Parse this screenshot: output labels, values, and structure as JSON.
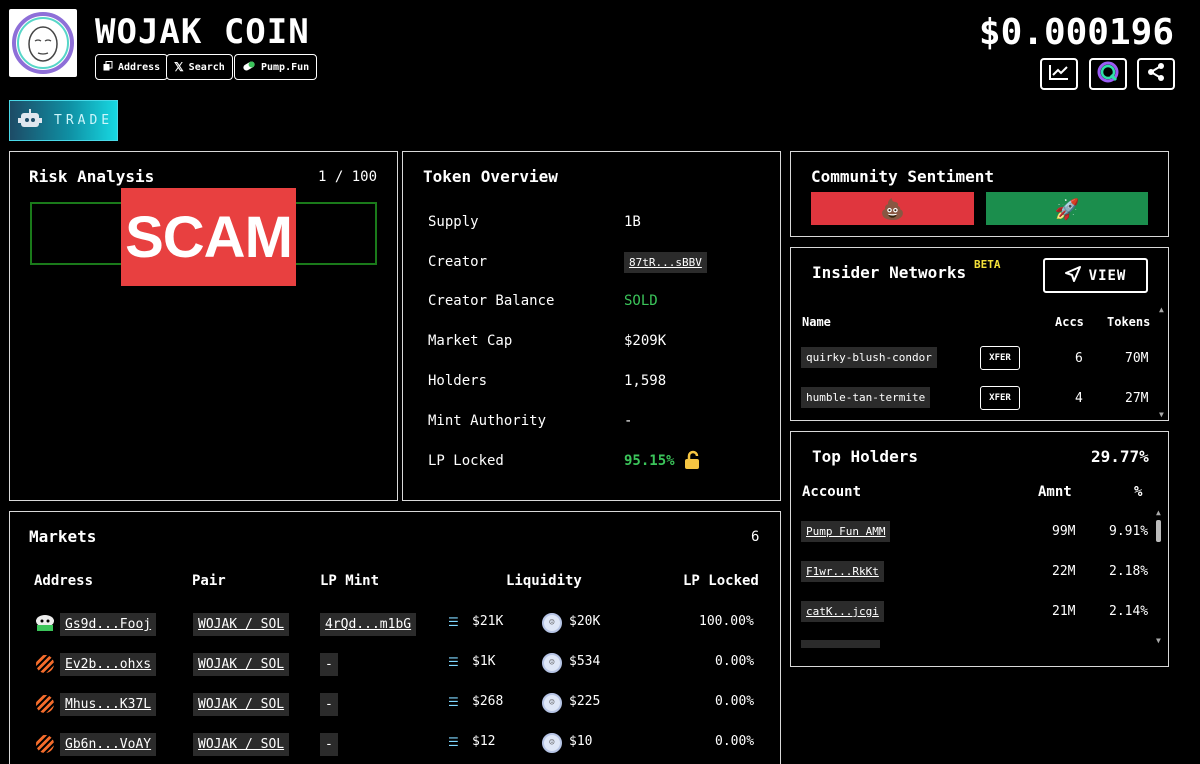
{
  "header": {
    "title": "WOJAK COIN",
    "price": "$0.000196",
    "buttons": {
      "address": "Address",
      "search": "Search",
      "pump": "Pump.Fun"
    },
    "trade": "TRADE"
  },
  "risk": {
    "title": "Risk Analysis",
    "score": "1 / 100",
    "verdict": "SCAM"
  },
  "overview": {
    "title": "Token Overview",
    "rows": [
      {
        "label": "Supply",
        "value": "1B"
      },
      {
        "label": "Creator",
        "value": "87tR...sBBV"
      },
      {
        "label": "Creator Balance",
        "value": "SOLD"
      },
      {
        "label": "Market Cap",
        "value": "$209K"
      },
      {
        "label": "Holders",
        "value": "1,598"
      },
      {
        "label": "Mint Authority",
        "value": "-"
      },
      {
        "label": "LP Locked",
        "value": "95.15%"
      }
    ]
  },
  "sentiment": {
    "title": "Community Sentiment",
    "bad_icon": "💩",
    "good_icon": "🚀"
  },
  "insiders": {
    "title": "Insider Networks",
    "beta": "BETA",
    "view": "VIEW",
    "headers": {
      "name": "Name",
      "accs": "Accs",
      "tokens": "Tokens"
    },
    "rows": [
      {
        "name": "quirky-blush-condor",
        "tag": "XFER",
        "accs": "6",
        "tokens": "70M"
      },
      {
        "name": "humble-tan-termite",
        "tag": "XFER",
        "accs": "4",
        "tokens": "27M"
      }
    ]
  },
  "holders": {
    "title": "Top Holders",
    "total": "29.77%",
    "headers": {
      "account": "Account",
      "amnt": "Amnt",
      "pct": "%"
    },
    "rows": [
      {
        "account": "Pump Fun AMM",
        "amnt": "99M",
        "pct": "9.91%"
      },
      {
        "account": "F1wr...RkKt",
        "amnt": "22M",
        "pct": "2.18%"
      },
      {
        "account": "catK...jcgi",
        "amnt": "21M",
        "pct": "2.14%"
      }
    ]
  },
  "markets": {
    "title": "Markets",
    "count": "6",
    "headers": {
      "address": "Address",
      "pair": "Pair",
      "lp_mint": "LP Mint",
      "liquidity": "Liquidity",
      "lp_locked": "LP Locked"
    },
    "rows": [
      {
        "address": "Gs9d...Fooj",
        "pair": "WOJAK / SOL",
        "lp_mint": "4rQd...m1bG",
        "liq_sol": "$21K",
        "liq_token": "$20K",
        "lp_locked": "100.00%"
      },
      {
        "address": "Ev2b...ohxs",
        "pair": "WOJAK / SOL",
        "lp_mint": "-",
        "liq_sol": "$1K",
        "liq_token": "$534",
        "lp_locked": "0.00%"
      },
      {
        "address": "Mhus...K37L",
        "pair": "WOJAK / SOL",
        "lp_mint": "-",
        "liq_sol": "$268",
        "liq_token": "$225",
        "lp_locked": "0.00%"
      },
      {
        "address": "Gb6n...VoAY",
        "pair": "WOJAK / SOL",
        "lp_mint": "-",
        "liq_sol": "$12",
        "liq_token": "$10",
        "lp_locked": "0.00%"
      }
    ]
  },
  "colors": {
    "scam": "#e84040",
    "green": "#3bc45a",
    "beta": "#f5e23a",
    "sent_bad": "#e0363e",
    "sent_good": "#1b8e4d"
  }
}
